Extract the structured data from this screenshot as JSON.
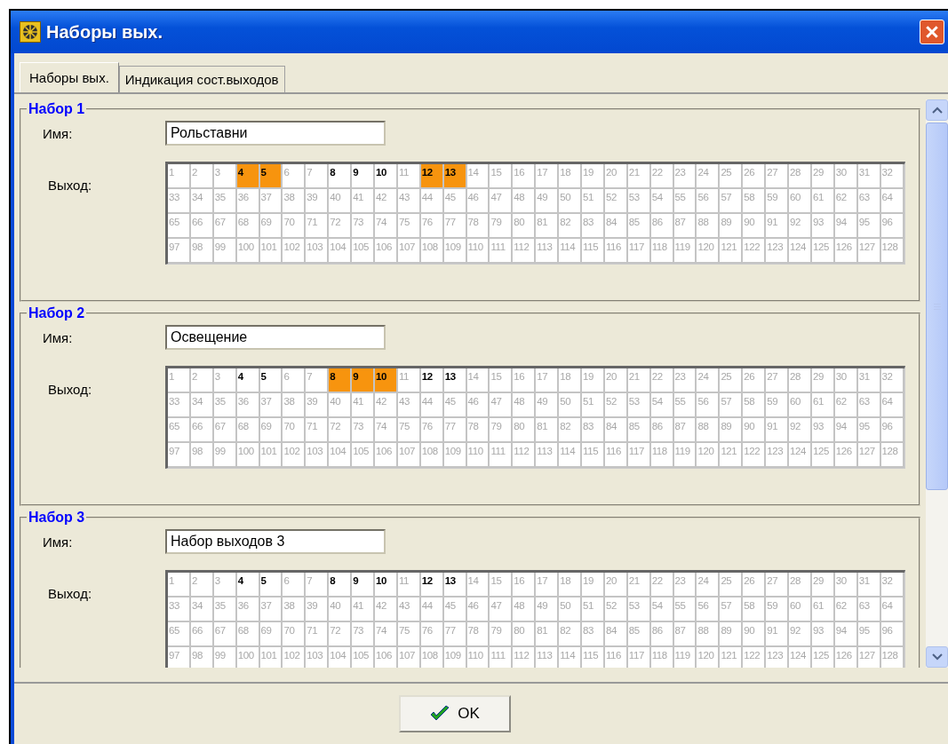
{
  "window": {
    "title": "Наборы вых."
  },
  "tabs": [
    {
      "label": "Наборы вых.",
      "selected": true
    },
    {
      "label": "Индикация сост.выходов",
      "selected": false
    }
  ],
  "sets": [
    {
      "title": "Набор 1",
      "name_label": "Имя:",
      "name_value": "Рольставни",
      "output_label": "Выход:",
      "cells": [
        {
          "n": "1",
          "enabled": false,
          "selected": false
        },
        {
          "n": "2",
          "enabled": false,
          "selected": false
        },
        {
          "n": "3",
          "enabled": false,
          "selected": false
        },
        {
          "n": "4",
          "enabled": true,
          "selected": true
        },
        {
          "n": "5",
          "enabled": true,
          "selected": true
        },
        {
          "n": "6",
          "enabled": false,
          "selected": false
        },
        {
          "n": "7",
          "enabled": false,
          "selected": false
        },
        {
          "n": "8",
          "enabled": true,
          "selected": false
        },
        {
          "n": "9",
          "enabled": true,
          "selected": false
        },
        {
          "n": "10",
          "enabled": true,
          "selected": false
        },
        {
          "n": "11",
          "enabled": false,
          "selected": false
        },
        {
          "n": "12",
          "enabled": true,
          "selected": true
        },
        {
          "n": "13",
          "enabled": true,
          "selected": true
        },
        {
          "n": "14",
          "enabled": false,
          "selected": false
        },
        {
          "n": "15",
          "enabled": false,
          "selected": false
        },
        {
          "n": "16",
          "enabled": false,
          "selected": false
        },
        {
          "n": "17",
          "enabled": false,
          "selected": false
        },
        {
          "n": "18",
          "enabled": false,
          "selected": false
        },
        {
          "n": "19",
          "enabled": false,
          "selected": false
        },
        {
          "n": "20",
          "enabled": false,
          "selected": false
        },
        {
          "n": "21",
          "enabled": false,
          "selected": false
        },
        {
          "n": "22",
          "enabled": false,
          "selected": false
        },
        {
          "n": "23",
          "enabled": false,
          "selected": false
        },
        {
          "n": "24",
          "enabled": false,
          "selected": false
        },
        {
          "n": "25",
          "enabled": false,
          "selected": false
        },
        {
          "n": "26",
          "enabled": false,
          "selected": false
        },
        {
          "n": "27",
          "enabled": false,
          "selected": false
        },
        {
          "n": "28",
          "enabled": false,
          "selected": false
        },
        {
          "n": "29",
          "enabled": false,
          "selected": false
        },
        {
          "n": "30",
          "enabled": false,
          "selected": false
        },
        {
          "n": "31",
          "enabled": false,
          "selected": false
        },
        {
          "n": "32",
          "enabled": false,
          "selected": false
        },
        {
          "n": "33",
          "enabled": false,
          "selected": false
        },
        {
          "n": "34",
          "enabled": false,
          "selected": false
        },
        {
          "n": "35",
          "enabled": false,
          "selected": false
        },
        {
          "n": "36",
          "enabled": false,
          "selected": false
        },
        {
          "n": "37",
          "enabled": false,
          "selected": false
        },
        {
          "n": "38",
          "enabled": false,
          "selected": false
        },
        {
          "n": "39",
          "enabled": false,
          "selected": false
        },
        {
          "n": "40",
          "enabled": false,
          "selected": false
        },
        {
          "n": "41",
          "enabled": false,
          "selected": false
        },
        {
          "n": "42",
          "enabled": false,
          "selected": false
        },
        {
          "n": "43",
          "enabled": false,
          "selected": false
        },
        {
          "n": "44",
          "enabled": false,
          "selected": false
        },
        {
          "n": "45",
          "enabled": false,
          "selected": false
        },
        {
          "n": "46",
          "enabled": false,
          "selected": false
        },
        {
          "n": "47",
          "enabled": false,
          "selected": false
        },
        {
          "n": "48",
          "enabled": false,
          "selected": false
        },
        {
          "n": "49",
          "enabled": false,
          "selected": false
        },
        {
          "n": "50",
          "enabled": false,
          "selected": false
        },
        {
          "n": "51",
          "enabled": false,
          "selected": false
        },
        {
          "n": "52",
          "enabled": false,
          "selected": false
        },
        {
          "n": "53",
          "enabled": false,
          "selected": false
        },
        {
          "n": "54",
          "enabled": false,
          "selected": false
        },
        {
          "n": "55",
          "enabled": false,
          "selected": false
        },
        {
          "n": "56",
          "enabled": false,
          "selected": false
        },
        {
          "n": "57",
          "enabled": false,
          "selected": false
        },
        {
          "n": "58",
          "enabled": false,
          "selected": false
        },
        {
          "n": "59",
          "enabled": false,
          "selected": false
        },
        {
          "n": "60",
          "enabled": false,
          "selected": false
        },
        {
          "n": "61",
          "enabled": false,
          "selected": false
        },
        {
          "n": "62",
          "enabled": false,
          "selected": false
        },
        {
          "n": "63",
          "enabled": false,
          "selected": false
        },
        {
          "n": "64",
          "enabled": false,
          "selected": false
        },
        {
          "n": "65",
          "enabled": false,
          "selected": false
        },
        {
          "n": "66",
          "enabled": false,
          "selected": false
        },
        {
          "n": "67",
          "enabled": false,
          "selected": false
        },
        {
          "n": "68",
          "enabled": false,
          "selected": false
        },
        {
          "n": "69",
          "enabled": false,
          "selected": false
        },
        {
          "n": "70",
          "enabled": false,
          "selected": false
        },
        {
          "n": "71",
          "enabled": false,
          "selected": false
        },
        {
          "n": "72",
          "enabled": false,
          "selected": false
        },
        {
          "n": "73",
          "enabled": false,
          "selected": false
        },
        {
          "n": "74",
          "enabled": false,
          "selected": false
        },
        {
          "n": "75",
          "enabled": false,
          "selected": false
        },
        {
          "n": "76",
          "enabled": false,
          "selected": false
        },
        {
          "n": "77",
          "enabled": false,
          "selected": false
        },
        {
          "n": "78",
          "enabled": false,
          "selected": false
        },
        {
          "n": "79",
          "enabled": false,
          "selected": false
        },
        {
          "n": "80",
          "enabled": false,
          "selected": false
        },
        {
          "n": "81",
          "enabled": false,
          "selected": false
        },
        {
          "n": "82",
          "enabled": false,
          "selected": false
        },
        {
          "n": "83",
          "enabled": false,
          "selected": false
        },
        {
          "n": "84",
          "enabled": false,
          "selected": false
        },
        {
          "n": "85",
          "enabled": false,
          "selected": false
        },
        {
          "n": "86",
          "enabled": false,
          "selected": false
        },
        {
          "n": "87",
          "enabled": false,
          "selected": false
        },
        {
          "n": "88",
          "enabled": false,
          "selected": false
        },
        {
          "n": "89",
          "enabled": false,
          "selected": false
        },
        {
          "n": "90",
          "enabled": false,
          "selected": false
        },
        {
          "n": "91",
          "enabled": false,
          "selected": false
        },
        {
          "n": "92",
          "enabled": false,
          "selected": false
        },
        {
          "n": "93",
          "enabled": false,
          "selected": false
        },
        {
          "n": "94",
          "enabled": false,
          "selected": false
        },
        {
          "n": "95",
          "enabled": false,
          "selected": false
        },
        {
          "n": "96",
          "enabled": false,
          "selected": false
        },
        {
          "n": "97",
          "enabled": false,
          "selected": false
        },
        {
          "n": "98",
          "enabled": false,
          "selected": false
        },
        {
          "n": "99",
          "enabled": false,
          "selected": false
        },
        {
          "n": "100",
          "enabled": false,
          "selected": false
        },
        {
          "n": "101",
          "enabled": false,
          "selected": false
        },
        {
          "n": "102",
          "enabled": false,
          "selected": false
        },
        {
          "n": "103",
          "enabled": false,
          "selected": false
        },
        {
          "n": "104",
          "enabled": false,
          "selected": false
        },
        {
          "n": "105",
          "enabled": false,
          "selected": false
        },
        {
          "n": "106",
          "enabled": false,
          "selected": false
        },
        {
          "n": "107",
          "enabled": false,
          "selected": false
        },
        {
          "n": "108",
          "enabled": false,
          "selected": false
        },
        {
          "n": "109",
          "enabled": false,
          "selected": false
        },
        {
          "n": "110",
          "enabled": false,
          "selected": false
        },
        {
          "n": "111",
          "enabled": false,
          "selected": false
        },
        {
          "n": "112",
          "enabled": false,
          "selected": false
        },
        {
          "n": "113",
          "enabled": false,
          "selected": false
        },
        {
          "n": "114",
          "enabled": false,
          "selected": false
        },
        {
          "n": "115",
          "enabled": false,
          "selected": false
        },
        {
          "n": "116",
          "enabled": false,
          "selected": false
        },
        {
          "n": "117",
          "enabled": false,
          "selected": false
        },
        {
          "n": "118",
          "enabled": false,
          "selected": false
        },
        {
          "n": "119",
          "enabled": false,
          "selected": false
        },
        {
          "n": "120",
          "enabled": false,
          "selected": false
        },
        {
          "n": "121",
          "enabled": false,
          "selected": false
        },
        {
          "n": "122",
          "enabled": false,
          "selected": false
        },
        {
          "n": "123",
          "enabled": false,
          "selected": false
        },
        {
          "n": "124",
          "enabled": false,
          "selected": false
        },
        {
          "n": "125",
          "enabled": false,
          "selected": false
        },
        {
          "n": "126",
          "enabled": false,
          "selected": false
        },
        {
          "n": "127",
          "enabled": false,
          "selected": false
        },
        {
          "n": "128",
          "enabled": false,
          "selected": false
        }
      ]
    },
    {
      "title": "Набор 2",
      "name_label": "Имя:",
      "name_value": "Освещение",
      "output_label": "Выход:",
      "cells": [
        {
          "n": "1",
          "enabled": false,
          "selected": false
        },
        {
          "n": "2",
          "enabled": false,
          "selected": false
        },
        {
          "n": "3",
          "enabled": false,
          "selected": false
        },
        {
          "n": "4",
          "enabled": true,
          "selected": false
        },
        {
          "n": "5",
          "enabled": true,
          "selected": false
        },
        {
          "n": "6",
          "enabled": false,
          "selected": false
        },
        {
          "n": "7",
          "enabled": false,
          "selected": false
        },
        {
          "n": "8",
          "enabled": true,
          "selected": true
        },
        {
          "n": "9",
          "enabled": true,
          "selected": true
        },
        {
          "n": "10",
          "enabled": true,
          "selected": true
        },
        {
          "n": "11",
          "enabled": false,
          "selected": false
        },
        {
          "n": "12",
          "enabled": true,
          "selected": false
        },
        {
          "n": "13",
          "enabled": true,
          "selected": false
        },
        {
          "n": "14",
          "enabled": false,
          "selected": false
        },
        {
          "n": "15",
          "enabled": false,
          "selected": false
        },
        {
          "n": "16",
          "enabled": false,
          "selected": false
        },
        {
          "n": "17",
          "enabled": false,
          "selected": false
        },
        {
          "n": "18",
          "enabled": false,
          "selected": false
        },
        {
          "n": "19",
          "enabled": false,
          "selected": false
        },
        {
          "n": "20",
          "enabled": false,
          "selected": false
        },
        {
          "n": "21",
          "enabled": false,
          "selected": false
        },
        {
          "n": "22",
          "enabled": false,
          "selected": false
        },
        {
          "n": "23",
          "enabled": false,
          "selected": false
        },
        {
          "n": "24",
          "enabled": false,
          "selected": false
        },
        {
          "n": "25",
          "enabled": false,
          "selected": false
        },
        {
          "n": "26",
          "enabled": false,
          "selected": false
        },
        {
          "n": "27",
          "enabled": false,
          "selected": false
        },
        {
          "n": "28",
          "enabled": false,
          "selected": false
        },
        {
          "n": "29",
          "enabled": false,
          "selected": false
        },
        {
          "n": "30",
          "enabled": false,
          "selected": false
        },
        {
          "n": "31",
          "enabled": false,
          "selected": false
        },
        {
          "n": "32",
          "enabled": false,
          "selected": false
        },
        {
          "n": "33",
          "enabled": false,
          "selected": false
        },
        {
          "n": "34",
          "enabled": false,
          "selected": false
        },
        {
          "n": "35",
          "enabled": false,
          "selected": false
        },
        {
          "n": "36",
          "enabled": false,
          "selected": false
        },
        {
          "n": "37",
          "enabled": false,
          "selected": false
        },
        {
          "n": "38",
          "enabled": false,
          "selected": false
        },
        {
          "n": "39",
          "enabled": false,
          "selected": false
        },
        {
          "n": "40",
          "enabled": false,
          "selected": false
        },
        {
          "n": "41",
          "enabled": false,
          "selected": false
        },
        {
          "n": "42",
          "enabled": false,
          "selected": false
        },
        {
          "n": "43",
          "enabled": false,
          "selected": false
        },
        {
          "n": "44",
          "enabled": false,
          "selected": false
        },
        {
          "n": "45",
          "enabled": false,
          "selected": false
        },
        {
          "n": "46",
          "enabled": false,
          "selected": false
        },
        {
          "n": "47",
          "enabled": false,
          "selected": false
        },
        {
          "n": "48",
          "enabled": false,
          "selected": false
        },
        {
          "n": "49",
          "enabled": false,
          "selected": false
        },
        {
          "n": "50",
          "enabled": false,
          "selected": false
        },
        {
          "n": "51",
          "enabled": false,
          "selected": false
        },
        {
          "n": "52",
          "enabled": false,
          "selected": false
        },
        {
          "n": "53",
          "enabled": false,
          "selected": false
        },
        {
          "n": "54",
          "enabled": false,
          "selected": false
        },
        {
          "n": "55",
          "enabled": false,
          "selected": false
        },
        {
          "n": "56",
          "enabled": false,
          "selected": false
        },
        {
          "n": "57",
          "enabled": false,
          "selected": false
        },
        {
          "n": "58",
          "enabled": false,
          "selected": false
        },
        {
          "n": "59",
          "enabled": false,
          "selected": false
        },
        {
          "n": "60",
          "enabled": false,
          "selected": false
        },
        {
          "n": "61",
          "enabled": false,
          "selected": false
        },
        {
          "n": "62",
          "enabled": false,
          "selected": false
        },
        {
          "n": "63",
          "enabled": false,
          "selected": false
        },
        {
          "n": "64",
          "enabled": false,
          "selected": false
        },
        {
          "n": "65",
          "enabled": false,
          "selected": false
        },
        {
          "n": "66",
          "enabled": false,
          "selected": false
        },
        {
          "n": "67",
          "enabled": false,
          "selected": false
        },
        {
          "n": "68",
          "enabled": false,
          "selected": false
        },
        {
          "n": "69",
          "enabled": false,
          "selected": false
        },
        {
          "n": "70",
          "enabled": false,
          "selected": false
        },
        {
          "n": "71",
          "enabled": false,
          "selected": false
        },
        {
          "n": "72",
          "enabled": false,
          "selected": false
        },
        {
          "n": "73",
          "enabled": false,
          "selected": false
        },
        {
          "n": "74",
          "enabled": false,
          "selected": false
        },
        {
          "n": "75",
          "enabled": false,
          "selected": false
        },
        {
          "n": "76",
          "enabled": false,
          "selected": false
        },
        {
          "n": "77",
          "enabled": false,
          "selected": false
        },
        {
          "n": "78",
          "enabled": false,
          "selected": false
        },
        {
          "n": "79",
          "enabled": false,
          "selected": false
        },
        {
          "n": "80",
          "enabled": false,
          "selected": false
        },
        {
          "n": "81",
          "enabled": false,
          "selected": false
        },
        {
          "n": "82",
          "enabled": false,
          "selected": false
        },
        {
          "n": "83",
          "enabled": false,
          "selected": false
        },
        {
          "n": "84",
          "enabled": false,
          "selected": false
        },
        {
          "n": "85",
          "enabled": false,
          "selected": false
        },
        {
          "n": "86",
          "enabled": false,
          "selected": false
        },
        {
          "n": "87",
          "enabled": false,
          "selected": false
        },
        {
          "n": "88",
          "enabled": false,
          "selected": false
        },
        {
          "n": "89",
          "enabled": false,
          "selected": false
        },
        {
          "n": "90",
          "enabled": false,
          "selected": false
        },
        {
          "n": "91",
          "enabled": false,
          "selected": false
        },
        {
          "n": "92",
          "enabled": false,
          "selected": false
        },
        {
          "n": "93",
          "enabled": false,
          "selected": false
        },
        {
          "n": "94",
          "enabled": false,
          "selected": false
        },
        {
          "n": "95",
          "enabled": false,
          "selected": false
        },
        {
          "n": "96",
          "enabled": false,
          "selected": false
        },
        {
          "n": "97",
          "enabled": false,
          "selected": false
        },
        {
          "n": "98",
          "enabled": false,
          "selected": false
        },
        {
          "n": "99",
          "enabled": false,
          "selected": false
        },
        {
          "n": "100",
          "enabled": false,
          "selected": false
        },
        {
          "n": "101",
          "enabled": false,
          "selected": false
        },
        {
          "n": "102",
          "enabled": false,
          "selected": false
        },
        {
          "n": "103",
          "enabled": false,
          "selected": false
        },
        {
          "n": "104",
          "enabled": false,
          "selected": false
        },
        {
          "n": "105",
          "enabled": false,
          "selected": false
        },
        {
          "n": "106",
          "enabled": false,
          "selected": false
        },
        {
          "n": "107",
          "enabled": false,
          "selected": false
        },
        {
          "n": "108",
          "enabled": false,
          "selected": false
        },
        {
          "n": "109",
          "enabled": false,
          "selected": false
        },
        {
          "n": "110",
          "enabled": false,
          "selected": false
        },
        {
          "n": "111",
          "enabled": false,
          "selected": false
        },
        {
          "n": "112",
          "enabled": false,
          "selected": false
        },
        {
          "n": "113",
          "enabled": false,
          "selected": false
        },
        {
          "n": "114",
          "enabled": false,
          "selected": false
        },
        {
          "n": "115",
          "enabled": false,
          "selected": false
        },
        {
          "n": "116",
          "enabled": false,
          "selected": false
        },
        {
          "n": "117",
          "enabled": false,
          "selected": false
        },
        {
          "n": "118",
          "enabled": false,
          "selected": false
        },
        {
          "n": "119",
          "enabled": false,
          "selected": false
        },
        {
          "n": "120",
          "enabled": false,
          "selected": false
        },
        {
          "n": "121",
          "enabled": false,
          "selected": false
        },
        {
          "n": "122",
          "enabled": false,
          "selected": false
        },
        {
          "n": "123",
          "enabled": false,
          "selected": false
        },
        {
          "n": "124",
          "enabled": false,
          "selected": false
        },
        {
          "n": "125",
          "enabled": false,
          "selected": false
        },
        {
          "n": "126",
          "enabled": false,
          "selected": false
        },
        {
          "n": "127",
          "enabled": false,
          "selected": false
        },
        {
          "n": "128",
          "enabled": false,
          "selected": false
        }
      ]
    },
    {
      "title": "Набор 3",
      "name_label": "Имя:",
      "name_value": "Набор выходов 3",
      "output_label": "Выход:",
      "cells": [
        {
          "n": "1",
          "enabled": false,
          "selected": false
        },
        {
          "n": "2",
          "enabled": false,
          "selected": false
        },
        {
          "n": "3",
          "enabled": false,
          "selected": false
        },
        {
          "n": "4",
          "enabled": true,
          "selected": false
        },
        {
          "n": "5",
          "enabled": true,
          "selected": false
        },
        {
          "n": "6",
          "enabled": false,
          "selected": false
        },
        {
          "n": "7",
          "enabled": false,
          "selected": false
        },
        {
          "n": "8",
          "enabled": true,
          "selected": false
        },
        {
          "n": "9",
          "enabled": true,
          "selected": false
        },
        {
          "n": "10",
          "enabled": true,
          "selected": false
        },
        {
          "n": "11",
          "enabled": false,
          "selected": false
        },
        {
          "n": "12",
          "enabled": true,
          "selected": false
        },
        {
          "n": "13",
          "enabled": true,
          "selected": false
        },
        {
          "n": "14",
          "enabled": false,
          "selected": false
        },
        {
          "n": "15",
          "enabled": false,
          "selected": false
        },
        {
          "n": "16",
          "enabled": false,
          "selected": false
        },
        {
          "n": "17",
          "enabled": false,
          "selected": false
        },
        {
          "n": "18",
          "enabled": false,
          "selected": false
        },
        {
          "n": "19",
          "enabled": false,
          "selected": false
        },
        {
          "n": "20",
          "enabled": false,
          "selected": false
        },
        {
          "n": "21",
          "enabled": false,
          "selected": false
        },
        {
          "n": "22",
          "enabled": false,
          "selected": false
        },
        {
          "n": "23",
          "enabled": false,
          "selected": false
        },
        {
          "n": "24",
          "enabled": false,
          "selected": false
        },
        {
          "n": "25",
          "enabled": false,
          "selected": false
        },
        {
          "n": "26",
          "enabled": false,
          "selected": false
        },
        {
          "n": "27",
          "enabled": false,
          "selected": false
        },
        {
          "n": "28",
          "enabled": false,
          "selected": false
        },
        {
          "n": "29",
          "enabled": false,
          "selected": false
        },
        {
          "n": "30",
          "enabled": false,
          "selected": false
        },
        {
          "n": "31",
          "enabled": false,
          "selected": false
        },
        {
          "n": "32",
          "enabled": false,
          "selected": false
        },
        {
          "n": "33",
          "enabled": false,
          "selected": false
        },
        {
          "n": "34",
          "enabled": false,
          "selected": false
        },
        {
          "n": "35",
          "enabled": false,
          "selected": false
        },
        {
          "n": "36",
          "enabled": false,
          "selected": false
        },
        {
          "n": "37",
          "enabled": false,
          "selected": false
        },
        {
          "n": "38",
          "enabled": false,
          "selected": false
        },
        {
          "n": "39",
          "enabled": false,
          "selected": false
        },
        {
          "n": "40",
          "enabled": false,
          "selected": false
        },
        {
          "n": "41",
          "enabled": false,
          "selected": false
        },
        {
          "n": "42",
          "enabled": false,
          "selected": false
        },
        {
          "n": "43",
          "enabled": false,
          "selected": false
        },
        {
          "n": "44",
          "enabled": false,
          "selected": false
        },
        {
          "n": "45",
          "enabled": false,
          "selected": false
        },
        {
          "n": "46",
          "enabled": false,
          "selected": false
        },
        {
          "n": "47",
          "enabled": false,
          "selected": false
        },
        {
          "n": "48",
          "enabled": false,
          "selected": false
        },
        {
          "n": "49",
          "enabled": false,
          "selected": false
        },
        {
          "n": "50",
          "enabled": false,
          "selected": false
        },
        {
          "n": "51",
          "enabled": false,
          "selected": false
        },
        {
          "n": "52",
          "enabled": false,
          "selected": false
        },
        {
          "n": "53",
          "enabled": false,
          "selected": false
        },
        {
          "n": "54",
          "enabled": false,
          "selected": false
        },
        {
          "n": "55",
          "enabled": false,
          "selected": false
        },
        {
          "n": "56",
          "enabled": false,
          "selected": false
        },
        {
          "n": "57",
          "enabled": false,
          "selected": false
        },
        {
          "n": "58",
          "enabled": false,
          "selected": false
        },
        {
          "n": "59",
          "enabled": false,
          "selected": false
        },
        {
          "n": "60",
          "enabled": false,
          "selected": false
        },
        {
          "n": "61",
          "enabled": false,
          "selected": false
        },
        {
          "n": "62",
          "enabled": false,
          "selected": false
        },
        {
          "n": "63",
          "enabled": false,
          "selected": false
        },
        {
          "n": "64",
          "enabled": false,
          "selected": false
        },
        {
          "n": "65",
          "enabled": false,
          "selected": false
        },
        {
          "n": "66",
          "enabled": false,
          "selected": false
        },
        {
          "n": "67",
          "enabled": false,
          "selected": false
        },
        {
          "n": "68",
          "enabled": false,
          "selected": false
        },
        {
          "n": "69",
          "enabled": false,
          "selected": false
        },
        {
          "n": "70",
          "enabled": false,
          "selected": false
        },
        {
          "n": "71",
          "enabled": false,
          "selected": false
        },
        {
          "n": "72",
          "enabled": false,
          "selected": false
        },
        {
          "n": "73",
          "enabled": false,
          "selected": false
        },
        {
          "n": "74",
          "enabled": false,
          "selected": false
        },
        {
          "n": "75",
          "enabled": false,
          "selected": false
        },
        {
          "n": "76",
          "enabled": false,
          "selected": false
        },
        {
          "n": "77",
          "enabled": false,
          "selected": false
        },
        {
          "n": "78",
          "enabled": false,
          "selected": false
        },
        {
          "n": "79",
          "enabled": false,
          "selected": false
        },
        {
          "n": "80",
          "enabled": false,
          "selected": false
        },
        {
          "n": "81",
          "enabled": false,
          "selected": false
        },
        {
          "n": "82",
          "enabled": false,
          "selected": false
        },
        {
          "n": "83",
          "enabled": false,
          "selected": false
        },
        {
          "n": "84",
          "enabled": false,
          "selected": false
        },
        {
          "n": "85",
          "enabled": false,
          "selected": false
        },
        {
          "n": "86",
          "enabled": false,
          "selected": false
        },
        {
          "n": "87",
          "enabled": false,
          "selected": false
        },
        {
          "n": "88",
          "enabled": false,
          "selected": false
        },
        {
          "n": "89",
          "enabled": false,
          "selected": false
        },
        {
          "n": "90",
          "enabled": false,
          "selected": false
        },
        {
          "n": "91",
          "enabled": false,
          "selected": false
        },
        {
          "n": "92",
          "enabled": false,
          "selected": false
        },
        {
          "n": "93",
          "enabled": false,
          "selected": false
        },
        {
          "n": "94",
          "enabled": false,
          "selected": false
        },
        {
          "n": "95",
          "enabled": false,
          "selected": false
        },
        {
          "n": "96",
          "enabled": false,
          "selected": false
        },
        {
          "n": "97",
          "enabled": false,
          "selected": false
        },
        {
          "n": "98",
          "enabled": false,
          "selected": false
        },
        {
          "n": "99",
          "enabled": false,
          "selected": false
        },
        {
          "n": "100",
          "enabled": false,
          "selected": false
        },
        {
          "n": "101",
          "enabled": false,
          "selected": false
        },
        {
          "n": "102",
          "enabled": false,
          "selected": false
        },
        {
          "n": "103",
          "enabled": false,
          "selected": false
        },
        {
          "n": "104",
          "enabled": false,
          "selected": false
        },
        {
          "n": "105",
          "enabled": false,
          "selected": false
        },
        {
          "n": "106",
          "enabled": false,
          "selected": false
        },
        {
          "n": "107",
          "enabled": false,
          "selected": false
        },
        {
          "n": "108",
          "enabled": false,
          "selected": false
        },
        {
          "n": "109",
          "enabled": false,
          "selected": false
        },
        {
          "n": "110",
          "enabled": false,
          "selected": false
        },
        {
          "n": "111",
          "enabled": false,
          "selected": false
        },
        {
          "n": "112",
          "enabled": false,
          "selected": false
        },
        {
          "n": "113",
          "enabled": false,
          "selected": false
        },
        {
          "n": "114",
          "enabled": false,
          "selected": false
        },
        {
          "n": "115",
          "enabled": false,
          "selected": false
        },
        {
          "n": "116",
          "enabled": false,
          "selected": false
        },
        {
          "n": "117",
          "enabled": false,
          "selected": false
        },
        {
          "n": "118",
          "enabled": false,
          "selected": false
        },
        {
          "n": "119",
          "enabled": false,
          "selected": false
        },
        {
          "n": "120",
          "enabled": false,
          "selected": false
        },
        {
          "n": "121",
          "enabled": false,
          "selected": false
        },
        {
          "n": "122",
          "enabled": false,
          "selected": false
        },
        {
          "n": "123",
          "enabled": false,
          "selected": false
        },
        {
          "n": "124",
          "enabled": false,
          "selected": false
        },
        {
          "n": "125",
          "enabled": false,
          "selected": false
        },
        {
          "n": "126",
          "enabled": false,
          "selected": false
        },
        {
          "n": "127",
          "enabled": false,
          "selected": false
        },
        {
          "n": "128",
          "enabled": false,
          "selected": false
        }
      ]
    }
  ],
  "ok_button": {
    "label": "OK"
  }
}
